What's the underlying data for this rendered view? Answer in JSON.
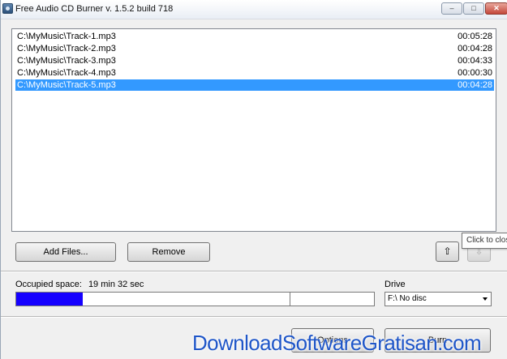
{
  "window": {
    "title": "Free Audio CD Burner  v. 1.5.2 build 718",
    "minimize_glyph": "–",
    "maximize_glyph": "□",
    "close_glyph": "✕"
  },
  "tracks": [
    {
      "path": "C:\\MyMusic\\Track-1.mp3",
      "duration": "00:05:28",
      "selected": false
    },
    {
      "path": "C:\\MyMusic\\Track-2.mp3",
      "duration": "00:04:28",
      "selected": false
    },
    {
      "path": "C:\\MyMusic\\Track-3.mp3",
      "duration": "00:04:33",
      "selected": false
    },
    {
      "path": "C:\\MyMusic\\Track-4.mp3",
      "duration": "00:00:30",
      "selected": false
    },
    {
      "path": "C:\\MyMusic\\Track-5.mp3",
      "duration": "00:04:28",
      "selected": true
    }
  ],
  "buttons": {
    "add_files": "Add Files...",
    "remove": "Remove",
    "move_up_icon": "arrow-up-icon",
    "move_down_icon": "arrow-down-icon",
    "options": "Options",
    "burn": "Burn"
  },
  "tooltip": {
    "text": "Click to clos"
  },
  "space": {
    "label": "Occupied space:",
    "value": "19 min 32 sec",
    "fill_fraction": 0.185,
    "marker_fraction": 0.765,
    "fill_color": "#1500ff"
  },
  "drive": {
    "label": "Drive",
    "selected": "F:\\ No disc"
  },
  "watermark": {
    "text": "DownloadSoftwareGratisan.com"
  },
  "colors": {
    "selection": "#3399ff",
    "watermark": "#1f56c8"
  }
}
